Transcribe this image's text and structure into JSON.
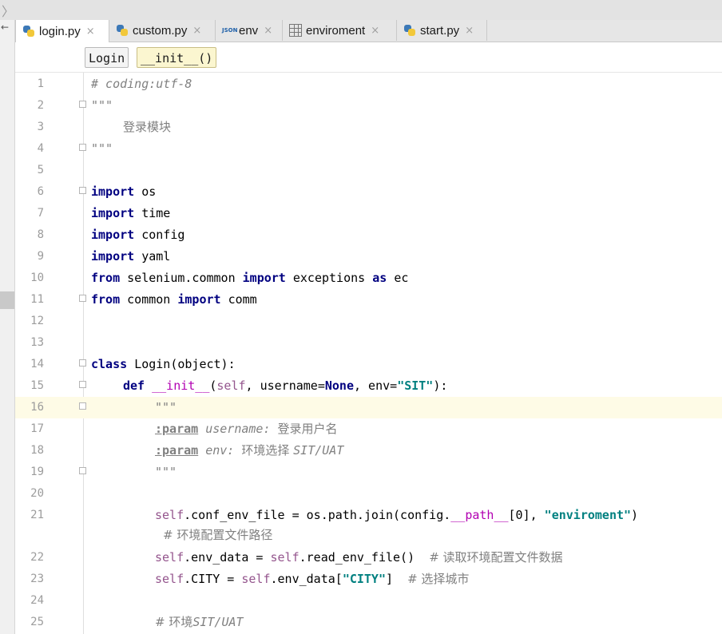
{
  "tabs": [
    {
      "label": "login.py",
      "icon": "python-file-icon",
      "active": true
    },
    {
      "label": "custom.py",
      "icon": "python-file-icon",
      "active": false
    },
    {
      "label": "env",
      "icon": "json-file-icon",
      "active": false
    },
    {
      "label": "enviroment",
      "icon": "table-file-icon",
      "active": false
    },
    {
      "label": "start.py",
      "icon": "python-file-icon",
      "active": false
    }
  ],
  "tab_close_glyph": "×",
  "breadcrumb": {
    "class_name": "Login",
    "method_name": "__init__()"
  },
  "line_numbers": [
    "1",
    "2",
    "3",
    "4",
    "5",
    "6",
    "7",
    "8",
    "9",
    "10",
    "11",
    "12",
    "13",
    "14",
    "15",
    "16",
    "17",
    "18",
    "19",
    "20",
    "21",
    "22",
    "23",
    "24",
    "25"
  ],
  "code": {
    "l1": "# coding:utf-8",
    "l2": "\"\"\"",
    "l3": "登录模块",
    "l4": "\"\"\"",
    "kw_import": "import",
    "kw_from": "from",
    "kw_as": "as",
    "kw_class": "class",
    "kw_def": "def",
    "kw_none": "None",
    "m_os": "os",
    "m_time": "time",
    "m_config": "config",
    "m_yaml": "yaml",
    "m_selenium": "selenium.common",
    "m_exceptions": "exceptions",
    "m_ec": "ec",
    "m_common": "common",
    "m_comm": "comm",
    "class_decl": "Login(object):",
    "init_name": "__init__",
    "self": "self",
    "param_username": ", username=",
    "param_env": ", env=",
    "str_sit": "\"SIT\"",
    "close_paren": "):",
    "doc_open": "\"\"\"",
    "doc_tag": ":param",
    "doc_username": " username: ",
    "doc_username_desc": "登录用户名",
    "doc_env": " env: ",
    "doc_env_desc": "环境选择 ",
    "doc_env_vals": "SIT/UAT",
    "doc_close": "\"\"\"",
    "l21_a": ".conf_env_file = os.path.join(config.",
    "l21_path": "__path__",
    "l21_b": "[0], ",
    "l21_str": "\"enviroment\"",
    "l21_c": ")",
    "l21_comment": "# 环境配置文件路径",
    "l22_a": ".env_data = ",
    "l22_b": ".read_env_file()  ",
    "l22_comment": "# 读取环境配置文件数据",
    "l23_a": ".CITY = ",
    "l23_b": ".env_data[",
    "l23_str": "\"CITY\"",
    "l23_c": "]  ",
    "l23_comment": "# 选择城市",
    "l25_comment": "# 环境",
    "l25_vals": "SIT/UAT"
  }
}
